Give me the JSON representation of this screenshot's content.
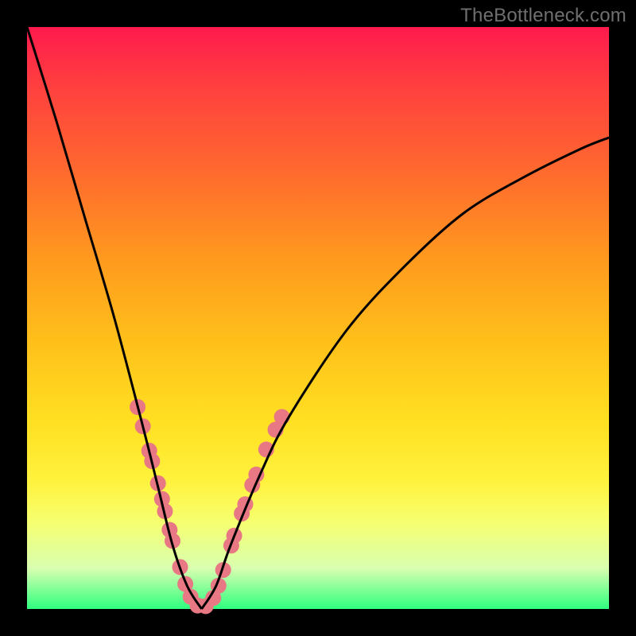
{
  "watermark": "TheBottleneck.com",
  "chart_data": {
    "type": "line",
    "title": "",
    "xlabel": "",
    "ylabel": "",
    "xlim": [
      0,
      1
    ],
    "ylim": [
      0,
      1
    ],
    "background_gradient": [
      "#ff1a4d",
      "#ff6a2e",
      "#ffc21a",
      "#fff23d",
      "#2fff7f"
    ],
    "series": [
      {
        "name": "curve-left",
        "x": [
          0.0,
          0.05,
          0.1,
          0.15,
          0.2,
          0.225,
          0.25,
          0.275,
          0.3
        ],
        "values": [
          1.0,
          0.84,
          0.67,
          0.5,
          0.31,
          0.21,
          0.11,
          0.04,
          0.0
        ],
        "stroke": "#000000"
      },
      {
        "name": "curve-right",
        "x": [
          0.3,
          0.325,
          0.35,
          0.4,
          0.45,
          0.55,
          0.65,
          0.75,
          0.85,
          0.95,
          1.0
        ],
        "values": [
          0.0,
          0.04,
          0.11,
          0.23,
          0.33,
          0.48,
          0.59,
          0.68,
          0.74,
          0.79,
          0.81
        ],
        "stroke": "#000000"
      }
    ],
    "markers": {
      "name": "highlighted-points",
      "color": "#e87884",
      "radius_px": 10,
      "points": [
        {
          "x": 0.19,
          "y": 0.347
        },
        {
          "x": 0.199,
          "y": 0.314
        },
        {
          "x": 0.21,
          "y": 0.272
        },
        {
          "x": 0.215,
          "y": 0.254
        },
        {
          "x": 0.225,
          "y": 0.216
        },
        {
          "x": 0.232,
          "y": 0.189
        },
        {
          "x": 0.237,
          "y": 0.168
        },
        {
          "x": 0.245,
          "y": 0.136
        },
        {
          "x": 0.25,
          "y": 0.117
        },
        {
          "x": 0.263,
          "y": 0.072
        },
        {
          "x": 0.272,
          "y": 0.043
        },
        {
          "x": 0.281,
          "y": 0.021
        },
        {
          "x": 0.293,
          "y": 0.006
        },
        {
          "x": 0.307,
          "y": 0.005
        },
        {
          "x": 0.32,
          "y": 0.019
        },
        {
          "x": 0.329,
          "y": 0.04
        },
        {
          "x": 0.337,
          "y": 0.067
        },
        {
          "x": 0.351,
          "y": 0.109
        },
        {
          "x": 0.356,
          "y": 0.126
        },
        {
          "x": 0.369,
          "y": 0.164
        },
        {
          "x": 0.375,
          "y": 0.18
        },
        {
          "x": 0.387,
          "y": 0.213
        },
        {
          "x": 0.394,
          "y": 0.231
        },
        {
          "x": 0.411,
          "y": 0.274
        },
        {
          "x": 0.427,
          "y": 0.308
        },
        {
          "x": 0.438,
          "y": 0.33
        }
      ]
    }
  }
}
